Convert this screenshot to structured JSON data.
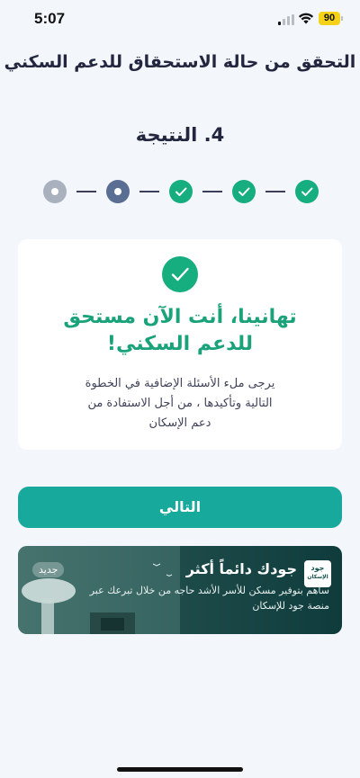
{
  "status_bar": {
    "time": "5:07",
    "battery": "90"
  },
  "header": {
    "title": "التحقق من حالة الاستحقاق للدعم السكني"
  },
  "step": {
    "title": "4. النتيجة",
    "total": 5,
    "completed": 3,
    "current": 4
  },
  "result": {
    "congrats_line1": "تهانينا، أنت الآن مستحق",
    "congrats_line2": "للدعم السكني!",
    "desc_line1": "يرجى ملء الأسئلة الإضافية في الخطوة",
    "desc_line2": "التالية وتأكيدها ، من أجل الاستفادة من",
    "desc_line3": "دعم الإسكان"
  },
  "actions": {
    "next_label": "التالي"
  },
  "banner": {
    "title": "جودك دائماً أكثر",
    "text_line1": "ساهم بتوفير مسكن للأسر الأشد حاجه من خلال تبرعك عبر",
    "text_line2": "منصة جود للإسكان",
    "badge": "جديد",
    "logo_line1": "جود",
    "logo_line2": "الإسكان"
  },
  "colors": {
    "accent": "#17a99c",
    "success": "#16ad7f",
    "current_step": "#5a6e93",
    "pending_step": "#a9b1bf",
    "background": "#f3f6fa"
  }
}
